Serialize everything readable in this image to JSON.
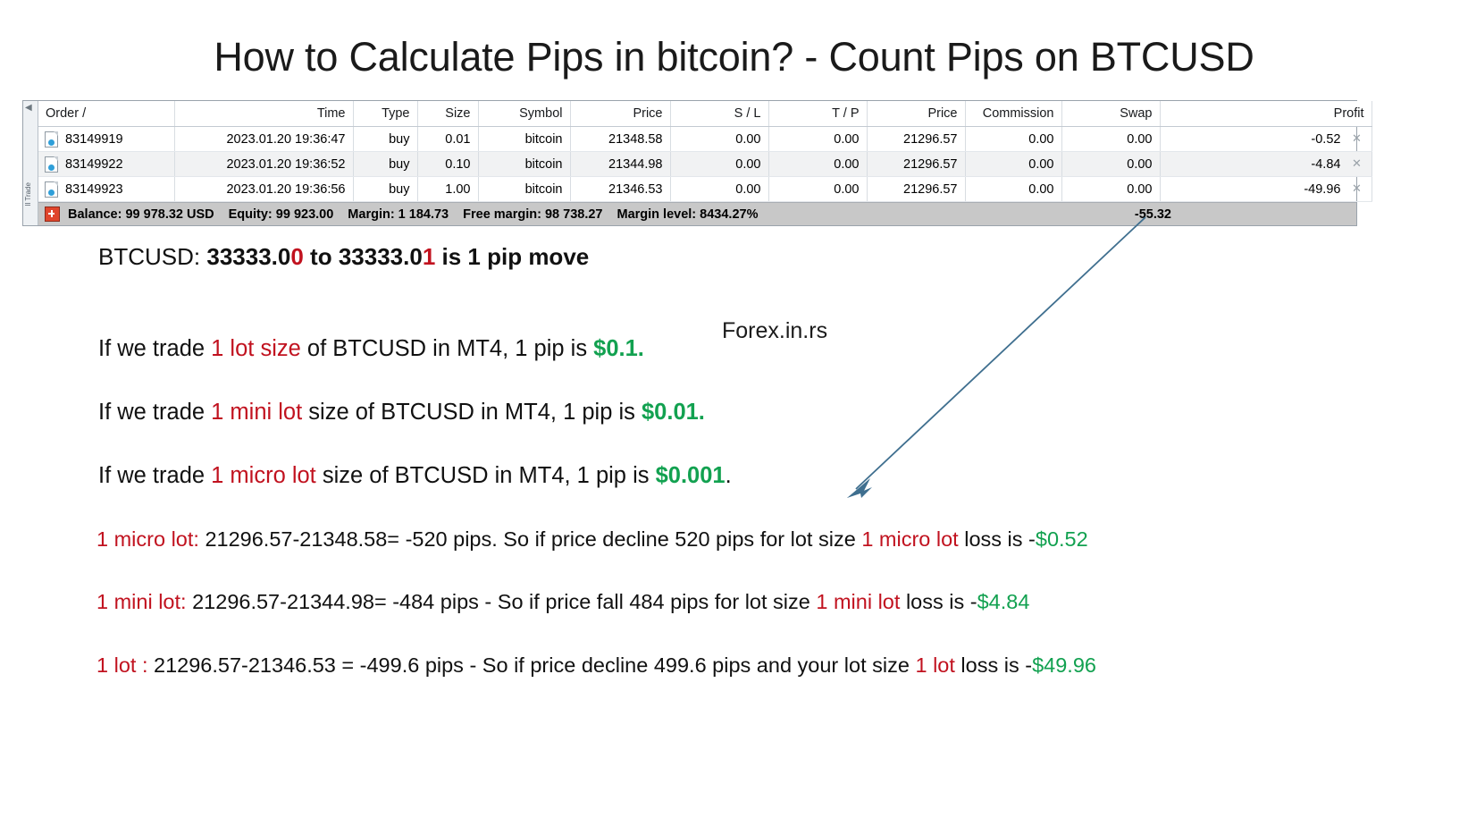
{
  "title": "How to Calculate Pips in bitcoin? - Count Pips on BTCUSD",
  "watermark": "Forex.in.rs",
  "colors": {
    "red": "#c1121f",
    "green": "#12a150",
    "text": "#111111",
    "balance_bar_bg": "#c8c8c8"
  },
  "terminal": {
    "columns": [
      "Order  /",
      "Time",
      "Type",
      "Size",
      "Symbol",
      "Price",
      "S / L",
      "T / P",
      "Price",
      "Commission",
      "Swap",
      "Profit"
    ],
    "rows": [
      {
        "order": "83149919",
        "time": "2023.01.20 19:36:47",
        "type": "buy",
        "size": "0.01",
        "symbol": "bitcoin",
        "open_price": "21348.58",
        "sl": "0.00",
        "tp": "0.00",
        "close_price": "21296.57",
        "commission": "0.00",
        "swap": "0.00",
        "profit": "-0.52",
        "close_icon": "close-x-icon"
      },
      {
        "order": "83149922",
        "time": "2023.01.20 19:36:52",
        "type": "buy",
        "size": "0.10",
        "symbol": "bitcoin",
        "open_price": "21344.98",
        "sl": "0.00",
        "tp": "0.00",
        "close_price": "21296.57",
        "commission": "0.00",
        "swap": "0.00",
        "profit": "-4.84",
        "close_icon": "close-x-icon"
      },
      {
        "order": "83149923",
        "time": "2023.01.20 19:36:56",
        "type": "buy",
        "size": "1.00",
        "symbol": "bitcoin",
        "open_price": "21346.53",
        "sl": "0.00",
        "tp": "0.00",
        "close_price": "21296.57",
        "commission": "0.00",
        "swap": "0.00",
        "profit": "-49.96",
        "close_icon": "close-x-icon"
      }
    ],
    "balance_bar": {
      "balance": "Balance: 99 978.32 USD",
      "equity": "Equity: 99 923.00",
      "margin": "Margin: 1 184.73",
      "free_margin": "Free margin: 98 738.27",
      "margin_level": "Margin level: 8434.27%",
      "total_profit": "-55.32"
    },
    "rail_label": "ll Trade"
  },
  "pip_move": {
    "label": "BTCUSD:",
    "from_base": "33333.0",
    "from_last": "0",
    "mid": "to",
    "to_base": "33333.0",
    "to_last": "1",
    "suffix": "is 1 pip move"
  },
  "lot_lines": [
    {
      "prefix": "If we trade",
      "lot": "1 lot size",
      "middle": "of BTCUSD in MT4, 1 pip is",
      "value": "$0.1.",
      "tail": ""
    },
    {
      "prefix": "If we trade",
      "lot": "1 mini lot",
      "middle": "size of BTCUSD in MT4, 1 pip is",
      "value": "$0.01.",
      "tail": ""
    },
    {
      "prefix": "If we trade",
      "lot": "1 micro lot",
      "middle": "size of BTCUSD in MT4, 1 pip is",
      "value": "$0.001",
      "tail": "."
    }
  ],
  "calc_lines": [
    {
      "lot_label": "1 micro lot:",
      "body": "21296.57-21348.58=  -520 pips.  So if price decline 520 pips for lot size",
      "lot_label2": "1 micro lot",
      "tail": "loss is -",
      "amount": "$0.52"
    },
    {
      "lot_label": "1 mini lot:",
      "body": "21296.57-21344.98= -484  pips - So if price fall 484 pips for lot size",
      "lot_label2": "1 mini  lot",
      "tail": "loss is -",
      "amount": "$4.84"
    },
    {
      "lot_label": "1 lot :",
      "body": "21296.57-21346.53 = -499.6 pips - So if price decline 499.6 pips and your lot size",
      "lot_label2": "1 lot",
      "tail": "loss is -",
      "amount": "$49.96"
    }
  ],
  "annotation_arrow": {
    "name": "pointer-arrow",
    "color": "#3f6f8f"
  }
}
